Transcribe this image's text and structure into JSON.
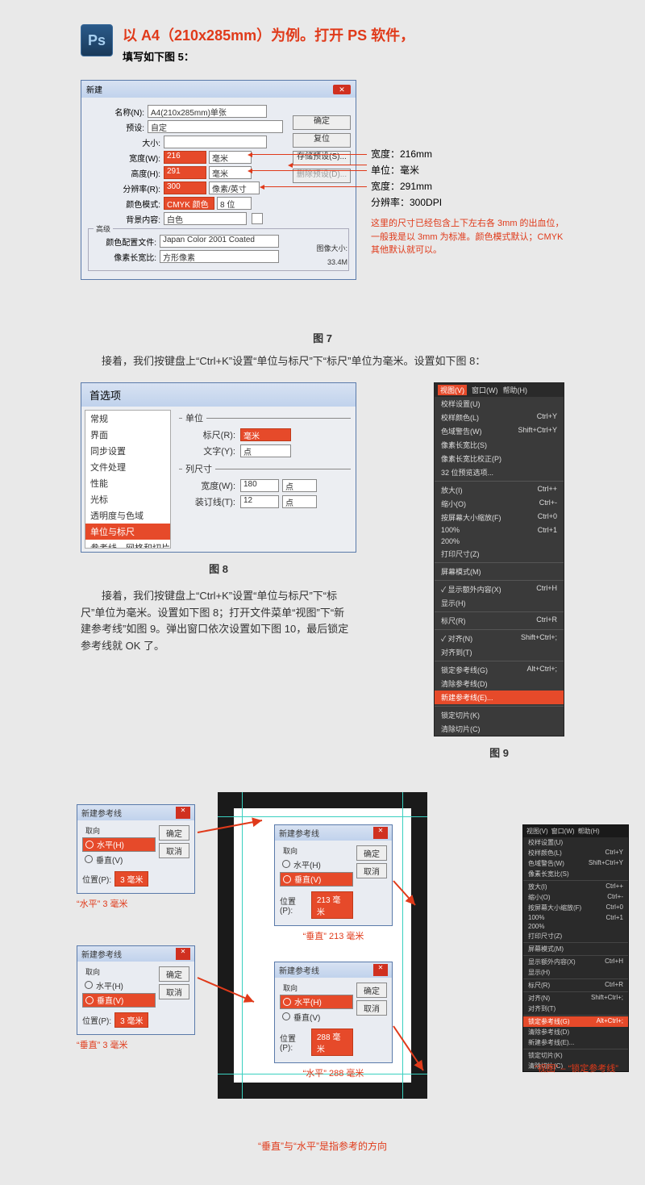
{
  "head": {
    "title": "以 A4（210x285mm）为例。打开 PS 软件，",
    "sub": "填写如下图 5："
  },
  "fig7": {
    "dlg_title": "新建",
    "name_lbl": "名称(N):",
    "name_val": "A4(210x285mm)单张",
    "preset_lbl": "预设:",
    "preset_val": "自定",
    "size_lbl": "大小:",
    "width_lbl": "宽度(W):",
    "width_val": "216",
    "height_lbl": "高度(H):",
    "height_val": "291",
    "res_lbl": "分辨率(R):",
    "res_val": "300",
    "mode_lbl": "颜色模式:",
    "mode_val": "CMYK 颜色",
    "mode_bit": "8 位",
    "bg_lbl": "背景内容:",
    "bg_val": "白色",
    "unit_mm": "毫米",
    "unit_ppi": "像素/英寸",
    "adv": "高级",
    "profile_lbl": "颜色配置文件:",
    "profile_val": "Japan Color 2001 Coated",
    "aspect_lbl": "像素长宽比:",
    "aspect_val": "方形像素",
    "btn_ok": "确定",
    "btn_reset": "复位",
    "btn_save": "存储预设(S)...",
    "btn_del": "删除预设(D)...",
    "imgsize_lbl": "图像大小:",
    "imgsize_val": "33.4M",
    "anno1": "宽度：216mm",
    "anno2": "单位：毫米",
    "anno3": "宽度：291mm",
    "anno4": "分辨率：300DPI",
    "anno_red": "这里的尺寸已经包含上下左右各 3mm 的出血位，一般我是以 3mm 为标准。颜色模式默认；CMYK 其他默认就可以。",
    "cap": "图 7"
  },
  "para1": "接着，我们按键盘上“Ctrl+K”设置“单位与标尺”下“标尺”单位为毫米。设置如下图 8：",
  "fig8": {
    "title": "首选项",
    "side_items": [
      "常规",
      "界面",
      "同步设置",
      "文件处理",
      "性能",
      "光标",
      "透明度与色域",
      "单位与标尺",
      "参考线、网格和切片"
    ],
    "selected_item": "单位与标尺",
    "unit_legend": "单位",
    "ruler_lbl": "标尺(R):",
    "ruler_val": "毫米",
    "type_lbl": "文字(Y):",
    "type_val": "点",
    "col_legend": "列尺寸",
    "colw_lbl": "宽度(W):",
    "colw_val": "180",
    "colw_u": "点",
    "gutter_lbl": "装订线(T):",
    "gutter_val": "12",
    "gutter_u": "点",
    "cap": "图 8"
  },
  "para2": "接着，我们按键盘上“Ctrl+K”设置“单位与标尺”下“标尺”单位为毫米。设置如下图 8；打开文件菜单“视图”下“新建参考线”如图 9。弹出窗口依次设置如下图 10，最后锁定参考线就 OK 了。",
  "menu9": {
    "top": [
      "视图(V)",
      "窗口(W)",
      "帮助(H)"
    ],
    "items": [
      {
        "t": "校样设置(U)",
        "k": ""
      },
      {
        "t": "校样颜色(L)",
        "k": "Ctrl+Y"
      },
      {
        "t": "色域警告(W)",
        "k": "Shift+Ctrl+Y"
      },
      {
        "t": "像素长宽比(S)",
        "k": ""
      },
      {
        "t": "像素长宽比校正(P)",
        "k": ""
      },
      {
        "t": "32 位预览选项...",
        "k": ""
      },
      {
        "sep": true
      },
      {
        "t": "放大(I)",
        "k": "Ctrl++"
      },
      {
        "t": "缩小(O)",
        "k": "Ctrl+-"
      },
      {
        "t": "按屏幕大小缩放(F)",
        "k": "Ctrl+0"
      },
      {
        "t": "100%",
        "k": "Ctrl+1"
      },
      {
        "t": "200%",
        "k": ""
      },
      {
        "t": "打印尺寸(Z)",
        "k": ""
      },
      {
        "sep": true
      },
      {
        "t": "屏幕模式(M)",
        "k": ""
      },
      {
        "sep": true
      },
      {
        "t": "显示额外内容(X)",
        "k": "Ctrl+H",
        "chk": true
      },
      {
        "t": "显示(H)",
        "k": ""
      },
      {
        "sep": true
      },
      {
        "t": "标尺(R)",
        "k": "Ctrl+R"
      },
      {
        "sep": true
      },
      {
        "t": "对齐(N)",
        "k": "Shift+Ctrl+;",
        "chk": true
      },
      {
        "t": "对齐到(T)",
        "k": ""
      },
      {
        "sep": true
      },
      {
        "t": "锁定参考线(G)",
        "k": "Alt+Ctrl+;"
      },
      {
        "t": "清除参考线(D)",
        "k": ""
      },
      {
        "t": "新建参考线(E)...",
        "k": "",
        "hl": true
      },
      {
        "sep": true
      },
      {
        "t": "锁定切片(K)",
        "k": ""
      },
      {
        "t": "清除切片(C)",
        "k": ""
      }
    ],
    "cap": "图 9"
  },
  "guides": {
    "title": "新建参考线",
    "orient": "取向",
    "hz": "水平(H)",
    "vt": "垂直(V)",
    "pos": "位置(P):",
    "ok": "确定",
    "cancel": "取消",
    "d1": {
      "sel": "hz",
      "val": "3 毫米",
      "cap": "“水平” 3 毫米"
    },
    "d2": {
      "sel": "vt",
      "val": "3 毫米",
      "cap": "“垂直” 3 毫米"
    },
    "d3": {
      "sel": "vt",
      "val": "213 毫米",
      "cap": "“垂直” 213 毫米"
    },
    "d4": {
      "sel": "hz",
      "val": "288 毫米",
      "cap": "“水平” 288 毫米"
    }
  },
  "menu11": {
    "top": [
      "视图(V)",
      "窗口(W)",
      "帮助(H)"
    ],
    "items": [
      {
        "t": "校样设置(U)",
        "k": ""
      },
      {
        "t": "校样颜色(L)",
        "k": "Ctrl+Y"
      },
      {
        "t": "色域警告(W)",
        "k": "Shift+Ctrl+Y"
      },
      {
        "t": "像素长宽比(S)",
        "k": ""
      },
      {
        "sep": true
      },
      {
        "t": "放大(I)",
        "k": "Ctrl++"
      },
      {
        "t": "缩小(O)",
        "k": "Ctrl+-"
      },
      {
        "t": "按屏幕大小缩放(F)",
        "k": "Ctrl+0"
      },
      {
        "t": "100%",
        "k": "Ctrl+1"
      },
      {
        "t": "200%",
        "k": ""
      },
      {
        "t": "打印尺寸(Z)",
        "k": ""
      },
      {
        "sep": true
      },
      {
        "t": "屏幕模式(M)",
        "k": ""
      },
      {
        "sep": true
      },
      {
        "t": "显示额外内容(X)",
        "k": "Ctrl+H"
      },
      {
        "t": "显示(H)",
        "k": ""
      },
      {
        "sep": true
      },
      {
        "t": "标尺(R)",
        "k": "Ctrl+R"
      },
      {
        "sep": true
      },
      {
        "t": "对齐(N)",
        "k": "Shift+Ctrl+;"
      },
      {
        "t": "对齐到(T)",
        "k": ""
      },
      {
        "sep": true
      },
      {
        "t": "锁定参考线(G)",
        "k": "Alt+Ctrl+;",
        "hl": true
      },
      {
        "t": "清除参考线(D)",
        "k": ""
      },
      {
        "t": "新建参考线(E)...",
        "k": ""
      },
      {
        "sep": true
      },
      {
        "t": "锁定切片(K)",
        "k": ""
      },
      {
        "t": "清除切片(C)",
        "k": ""
      }
    ],
    "cap": "“视图” – “锁定参考线”"
  },
  "footer": "“垂直”与“水平”是指参考的方向"
}
